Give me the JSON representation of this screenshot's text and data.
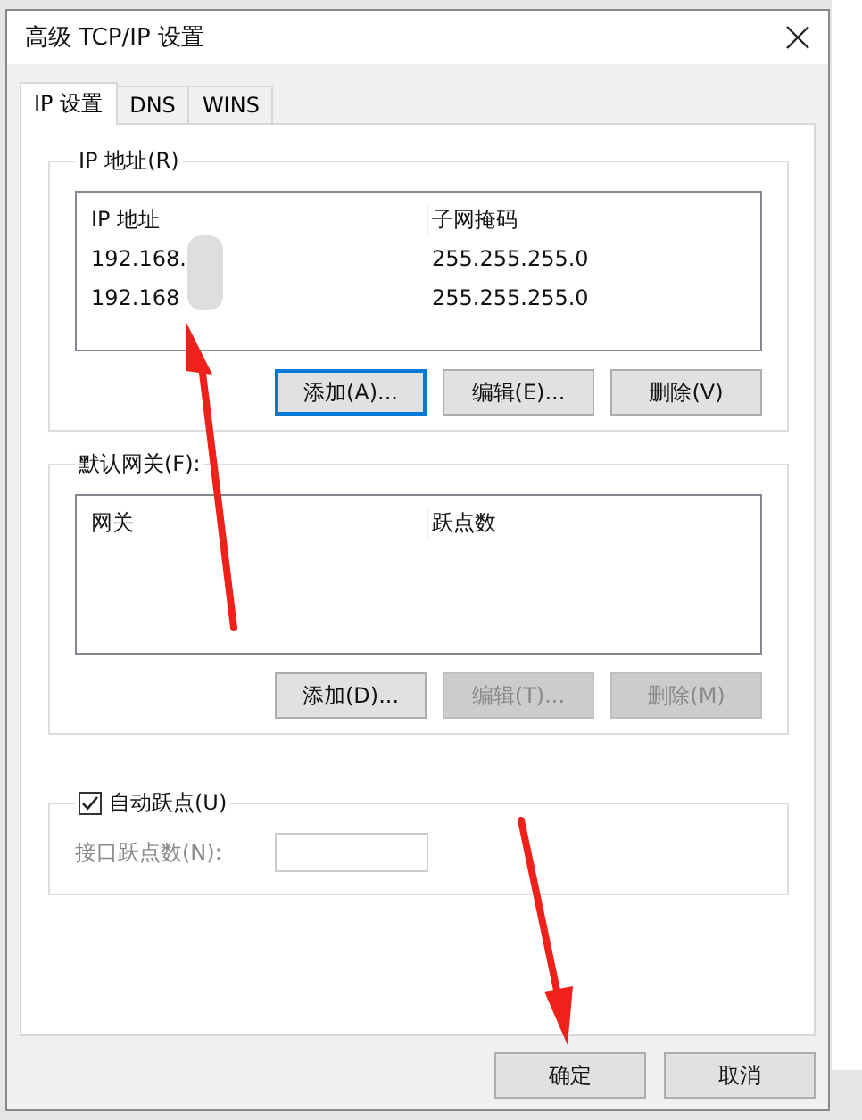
{
  "window": {
    "title": "高级 TCP/IP 设置"
  },
  "tabs": [
    {
      "label": "IP 设置",
      "selected": true
    },
    {
      "label": "DNS",
      "selected": false
    },
    {
      "label": "WINS",
      "selected": false
    }
  ],
  "ip_group": {
    "title": "IP 地址(R)",
    "columns": [
      "IP 地址",
      "子网掩码"
    ],
    "rows": [
      [
        "192.168.",
        "255.255.255.0"
      ],
      [
        "192.168",
        "255.255.255.0"
      ]
    ],
    "buttons": [
      {
        "label": "添加(A)...",
        "disabled": false,
        "focused": true
      },
      {
        "label": "编辑(E)...",
        "disabled": false,
        "focused": false
      },
      {
        "label": "删除(V)",
        "disabled": false,
        "focused": false
      }
    ]
  },
  "gateway_group": {
    "title": "默认网关(F):",
    "columns": [
      "网关",
      "跃点数"
    ],
    "buttons": [
      {
        "label": "添加(D)...",
        "disabled": false,
        "focused": false
      },
      {
        "label": "编辑(T)...",
        "disabled": true,
        "focused": false
      },
      {
        "label": "删除(M)",
        "disabled": true,
        "focused": false
      }
    ]
  },
  "auto_metric": {
    "label": "自动跃点(U)",
    "checked": true
  },
  "interface_metric": {
    "label": "接口跃点数(N):",
    "disabled": true
  },
  "footer_buttons": [
    "确定",
    "取消"
  ]
}
